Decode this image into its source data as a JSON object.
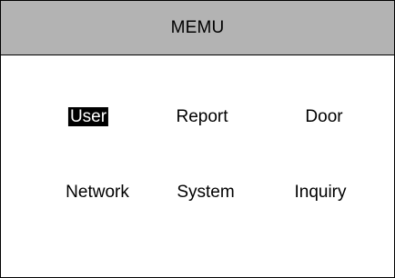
{
  "header": {
    "title": "MEMU"
  },
  "menu": {
    "items": [
      {
        "label": "User",
        "selected": true
      },
      {
        "label": "Report",
        "selected": false
      },
      {
        "label": "Door",
        "selected": false
      },
      {
        "label": "Network",
        "selected": false
      },
      {
        "label": "System",
        "selected": false
      },
      {
        "label": "Inquiry",
        "selected": false
      }
    ]
  },
  "colors": {
    "title_bar_background": "#b3b3b3",
    "selection_background": "#000000",
    "selection_text": "#ffffff"
  }
}
